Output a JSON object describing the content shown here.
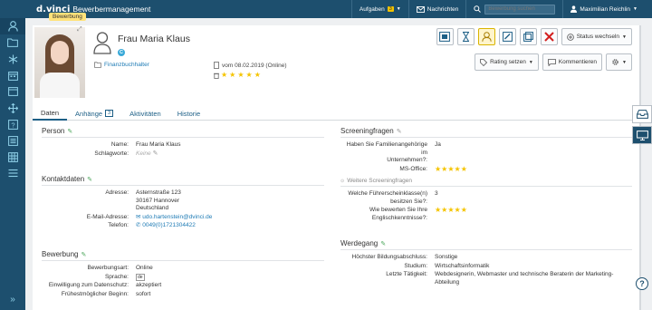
{
  "app": {
    "logo": "d.vinci",
    "title": "Bewerbermanagement",
    "tooltip": "Bewerbung"
  },
  "topnav": {
    "tasks_label": "Aufgaben",
    "tasks_count": "3",
    "messages_label": "Nachrichten",
    "search_placeholder": "Bewerbung suchen",
    "user_name": "Maximilian Reichlin"
  },
  "candidate": {
    "name": "Frau Maria Klaus",
    "status_letter": "C",
    "job": "Finanzbuchhalter",
    "applied": "vom 08.02.2019 (Online)",
    "rating_stars": 5
  },
  "toolbar": {
    "status_button": "Status wechseln",
    "rating_button": "Rating setzen",
    "comments_button": "Kommentieren"
  },
  "tabs": [
    {
      "label": "Daten"
    },
    {
      "label": "Anhänge",
      "count": "3"
    },
    {
      "label": "Aktivitäten"
    },
    {
      "label": "Historie"
    }
  ],
  "person": {
    "title": "Person",
    "name_label": "Name:",
    "name_value": "Frau Maria Klaus",
    "keywords_label": "Schlagworte:",
    "keywords_value": "Keine"
  },
  "contact": {
    "title": "Kontaktdaten",
    "address_label": "Adresse:",
    "address_line1": "Asternstraße 123",
    "address_line2": "30167 Hannover",
    "address_line3": "Deutschland",
    "email_label": "E-Mail-Adresse:",
    "email_value": "udo.hartenstein@dvinci.de",
    "phone_label": "Telefon:",
    "phone_value": "0049(0)1721304422"
  },
  "application": {
    "title": "Bewerbung",
    "type_label": "Bewerbungsart:",
    "type_value": "Online",
    "lang_label": "Sprache:",
    "lang_value": "de",
    "consent_label": "Einwilligung zum Datenschutz:",
    "consent_value": "akzeptiert",
    "start_label": "Frühestmöglicher Beginn:",
    "start_value": "sofort"
  },
  "screening": {
    "title": "Screeningfragen",
    "q1_label_a": "Haben Sie Familienangehörige im",
    "q1_label_b": "Unternehmen?:",
    "q1_value": "Ja",
    "q2_label": "MS-Office:",
    "q2_stars": 5,
    "more_title": "Weitere Screeningfragen",
    "q3_label_a": "Welche Führerscheinklasse(n)",
    "q3_label_b": "besitzen Sie?:",
    "q3_value": "3",
    "q4_label_a": "Wie bewerten Sie Ihre",
    "q4_label_b": "Englischkenntnisse?:",
    "q4_stars": 5
  },
  "career": {
    "title": "Werdegang",
    "edu_label": "Höchster Bildungsabschluss:",
    "edu_value": "Sonstige",
    "study_label": "Studium:",
    "study_value": "Wirtschaftsinformatik",
    "job_label": "Letzte Tätigkeit:",
    "job_value_1": "Webdesignerin, Webmaster und technische Beraterin der Marketing-",
    "job_value_2": "Abteilung"
  },
  "colors": {
    "topbar": "#1d4f6e",
    "accent": "#1e7bb5",
    "star": "#f5c400",
    "pencil": "#4aa65a"
  },
  "icons": [
    "user-icon",
    "folder-icon",
    "asterisk-icon",
    "calendar-icon",
    "move-icon",
    "help-icon",
    "list-icon",
    "table-icon",
    "inbox-icon",
    "monitor-icon"
  ]
}
